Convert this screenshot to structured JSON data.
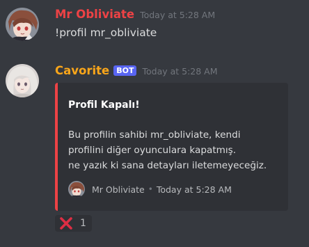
{
  "messages": [
    {
      "username": "Mr Obliviate",
      "username_color": "#ed4245",
      "timestamp": "Today at 5:28 AM",
      "content": "!profil mr_obliviate"
    },
    {
      "username": "Cavorite",
      "username_color": "#faa61a",
      "bot_tag": "BOT",
      "timestamp": "Today at 5:28 AM",
      "embed": {
        "accent_color": "#ed4245",
        "title": "Profil Kapalı!",
        "description_lines": [
          "Bu profilin sahibi mr_obliviate, kendi",
          "profilini diğer oyunculara kapatmış.",
          "ne yazık ki sana detayları iletemeyeceğiz."
        ],
        "footer_text": "Mr Obliviate",
        "footer_separator": "•",
        "footer_timestamp": "Today at 5:28 AM"
      },
      "reaction": {
        "emoji": "cross-mark-icon",
        "count": "1"
      }
    }
  ]
}
